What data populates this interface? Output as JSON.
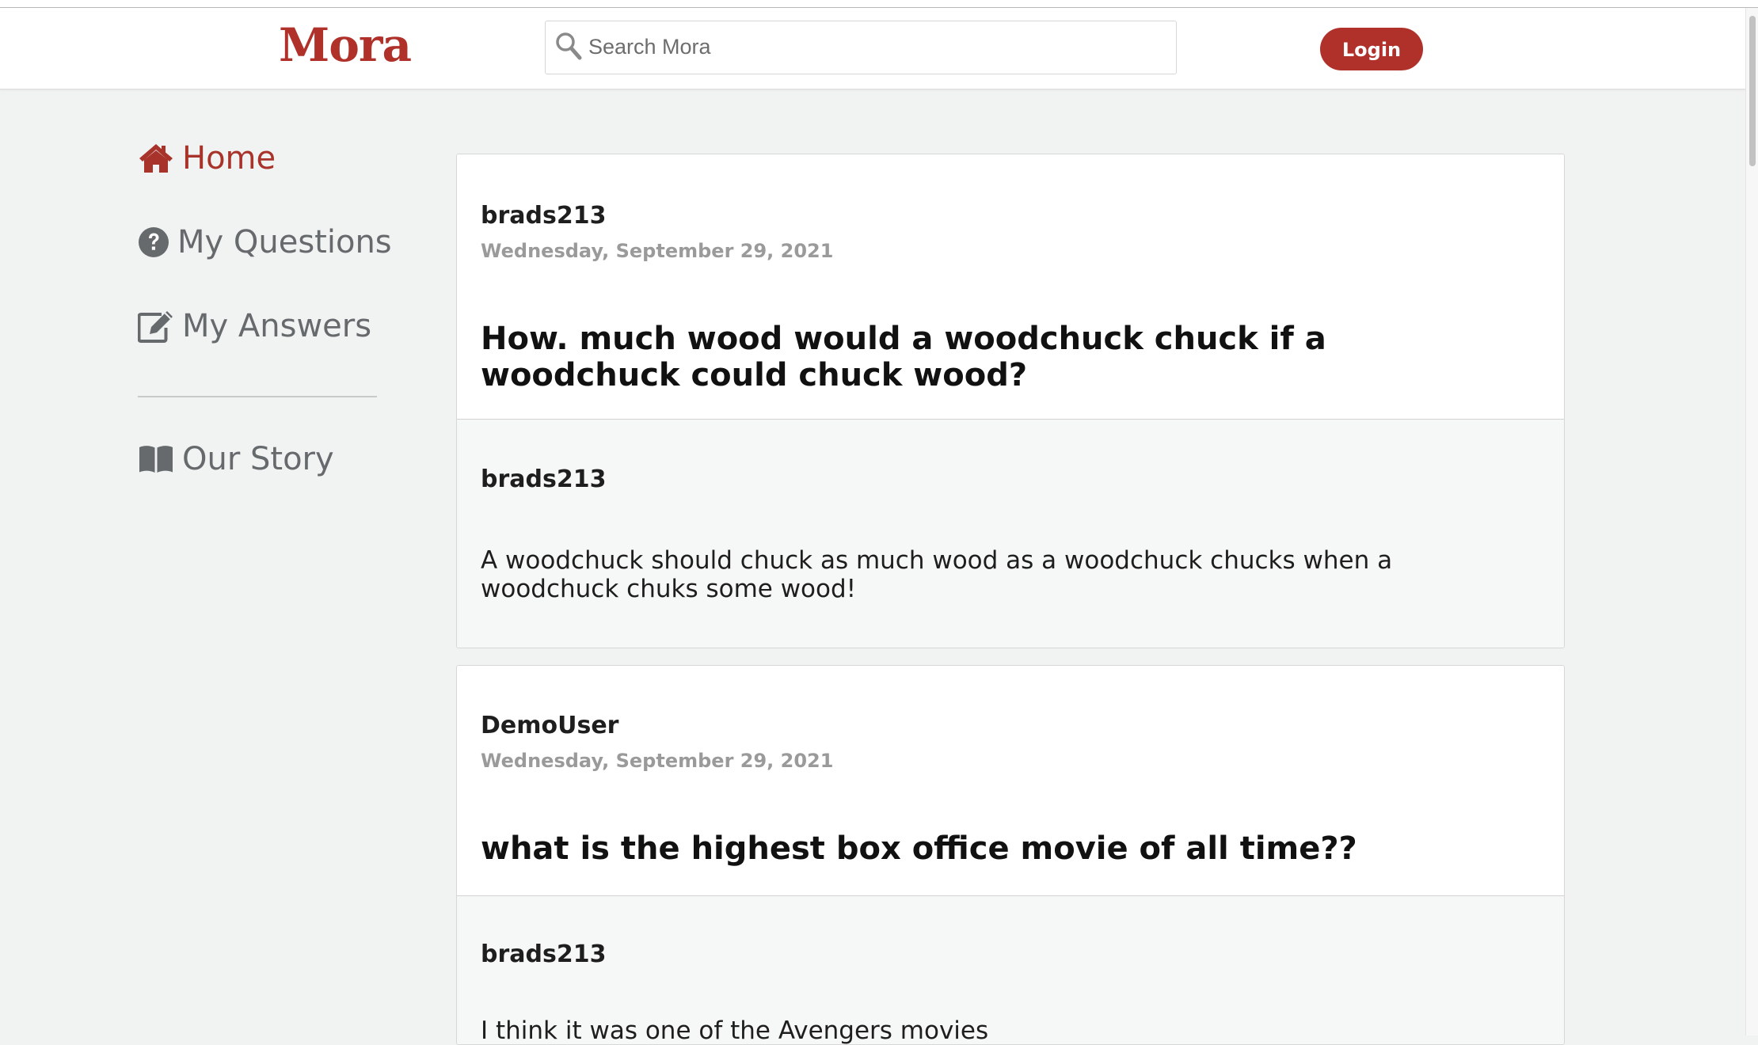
{
  "header": {
    "logo": "Mora",
    "search_placeholder": "Search Mora",
    "search_value": "",
    "login_label": "Login"
  },
  "sidebar": {
    "items": [
      {
        "label": "Home",
        "icon": "home-icon",
        "active": true
      },
      {
        "label": "My Questions",
        "icon": "question-circle-icon",
        "active": false
      },
      {
        "label": "My Answers",
        "icon": "edit-icon",
        "active": false
      },
      {
        "label": "Our Story",
        "icon": "book-icon",
        "active": false
      }
    ]
  },
  "colors": {
    "brand": "#b0312a",
    "background": "#f1f2f2",
    "nav_text": "#666a6d"
  },
  "feed": [
    {
      "author": "brads213",
      "date": "Wednesday, September 29, 2021",
      "question": "How. much wood would a woodchuck chuck if a woodchuck could chuck wood?",
      "answer": {
        "author": "brads213",
        "body": "A woodchuck should chuck as much wood as a woodchuck chucks when a woodchuck chuks some wood!"
      }
    },
    {
      "author": "DemoUser",
      "date": "Wednesday, September 29, 2021",
      "question": "what is the highest box office movie of all time??",
      "answer": {
        "author": "brads213",
        "body": "I think it was one of the Avengers movies"
      }
    }
  ]
}
